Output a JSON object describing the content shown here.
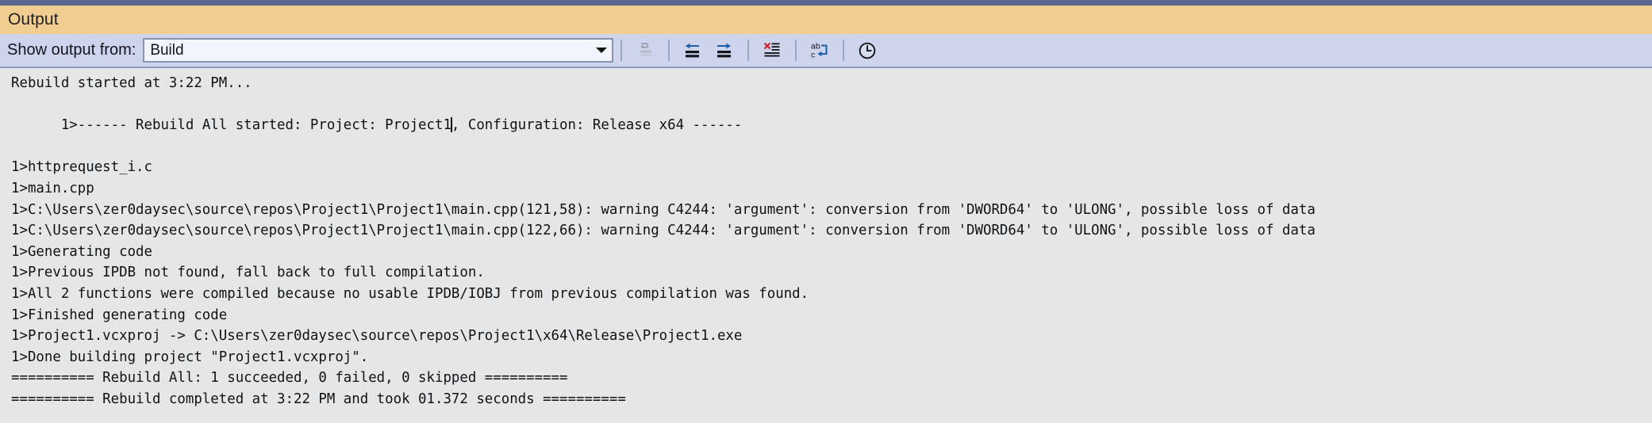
{
  "window": {
    "title": "Output",
    "accent_strip_color": "#5b6690",
    "title_bar_color": "#f2cd92",
    "toolbar_color": "#cdd4ec",
    "content_bg_color": "#e5e6e8"
  },
  "toolbar": {
    "show_output_from_label": "Show output from:",
    "source_combo": {
      "value": "Build",
      "placeholder": "Build",
      "arrow_icon": "chevron-down-icon"
    },
    "buttons": [
      {
        "name": "go-to-current-line-button",
        "icon": "go-to-current-line-icon",
        "enabled": false,
        "tooltip": "Find Message in Code"
      },
      {
        "name": "previous-message-button",
        "icon": "arrow-left-lines-icon",
        "enabled": true,
        "tooltip": "Go to Previous Message"
      },
      {
        "name": "next-message-button",
        "icon": "arrow-right-lines-icon",
        "enabled": true,
        "tooltip": "Go to Next Message"
      },
      {
        "name": "clear-all-button",
        "icon": "clear-all-icon",
        "enabled": true,
        "tooltip": "Clear All"
      },
      {
        "name": "toggle-word-wrap-button",
        "icon": "word-wrap-icon",
        "enabled": true,
        "tooltip": "Toggle Word Wrap"
      },
      {
        "name": "toggle-timestamps-button",
        "icon": "clock-icon",
        "enabled": true,
        "tooltip": "Show Timestamps"
      }
    ]
  },
  "output": {
    "lines": [
      "Rebuild started at 3:22 PM...",
      "1>------ Rebuild All started: Project: Project1, Configuration: Release x64 ------",
      "1>httprequest_i.c",
      "1>main.cpp",
      "1>C:\\Users\\zer0daysec\\source\\repos\\Project1\\Project1\\main.cpp(121,58): warning C4244: 'argument': conversion from 'DWORD64' to 'ULONG', possible loss of data",
      "1>C:\\Users\\zer0daysec\\source\\repos\\Project1\\Project1\\main.cpp(122,66): warning C4244: 'argument': conversion from 'DWORD64' to 'ULONG', possible loss of data",
      "1>Generating code",
      "1>Previous IPDB not found, fall back to full compilation.",
      "1>All 2 functions were compiled because no usable IPDB/IOBJ from previous compilation was found.",
      "1>Finished generating code",
      "1>Project1.vcxproj -> C:\\Users\\zer0daysec\\source\\repos\\Project1\\x64\\Release\\Project1.exe",
      "1>Done building project \"Project1.vcxproj\".",
      "========== Rebuild All: 1 succeeded, 0 failed, 0 skipped ==========",
      "========== Rebuild completed at 3:22 PM and took 01.372 seconds =========="
    ],
    "caret": {
      "line_index": 1,
      "column": 47,
      "visible": true
    }
  }
}
